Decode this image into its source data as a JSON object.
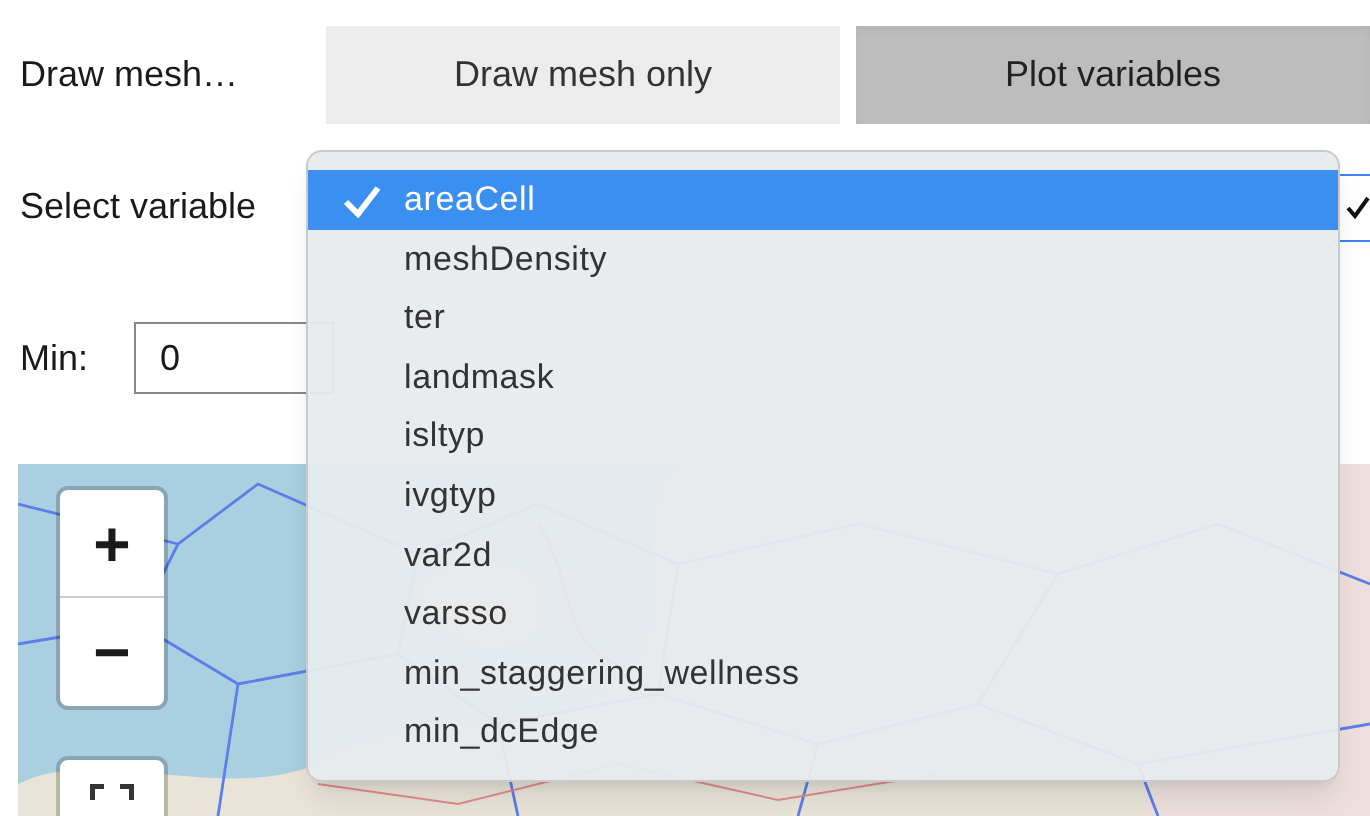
{
  "mode": {
    "label": "Draw mesh…",
    "options": [
      {
        "label": "Draw mesh only",
        "selected": false
      },
      {
        "label": "Plot variables",
        "selected": true
      }
    ]
  },
  "variable": {
    "label": "Select variable",
    "dropdown": {
      "expanded": true,
      "items": [
        {
          "label": "areaCell",
          "selected": true
        },
        {
          "label": "meshDensity",
          "selected": false
        },
        {
          "label": "ter",
          "selected": false
        },
        {
          "label": "landmask",
          "selected": false
        },
        {
          "label": "isltyp",
          "selected": false
        },
        {
          "label": "ivgtyp",
          "selected": false
        },
        {
          "label": "var2d",
          "selected": false
        },
        {
          "label": "varsso",
          "selected": false
        },
        {
          "label": "min_staggering_wellness",
          "selected": false
        },
        {
          "label": "min_dcEdge",
          "selected": false
        }
      ]
    }
  },
  "min": {
    "label": "Min:",
    "value": "0"
  },
  "map": {
    "zoom_in": "+",
    "zoom_out": "−"
  }
}
